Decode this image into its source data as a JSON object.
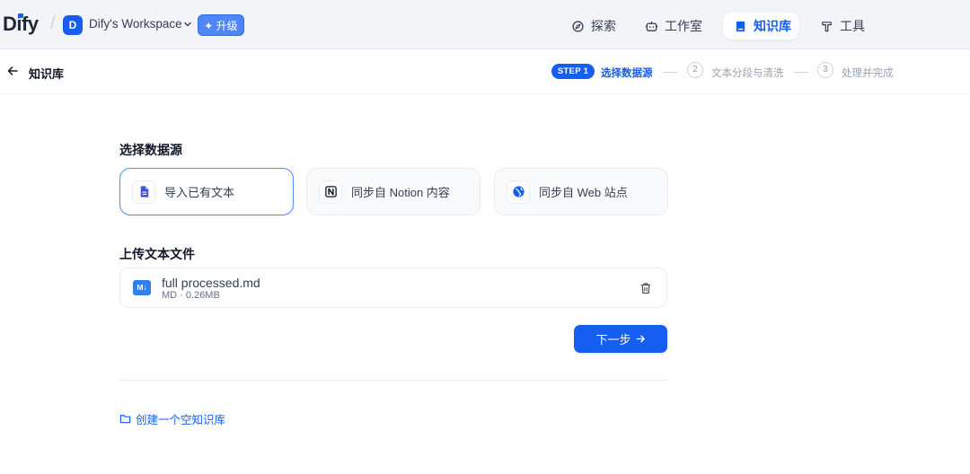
{
  "header": {
    "logo_prefix": "D",
    "logo_i": "i",
    "logo_suffix": "fy",
    "workspace_initial": "D",
    "workspace_name": "Dify's Workspace",
    "upgrade_label": "✦ 升级",
    "nav": [
      {
        "label": "探索",
        "icon": "compass-icon",
        "active": false
      },
      {
        "label": "工作室",
        "icon": "robot-icon",
        "active": false
      },
      {
        "label": "知识库",
        "icon": "book-icon",
        "active": true
      },
      {
        "label": "工具",
        "icon": "tools-icon",
        "active": false
      }
    ]
  },
  "subheader": {
    "title": "知识库",
    "steps": [
      {
        "badge": "STEP 1",
        "label": "选择数据源",
        "active": true
      },
      {
        "number": "2",
        "label": "文本分段与清洗",
        "active": false
      },
      {
        "number": "3",
        "label": "处理并完成",
        "active": false
      }
    ]
  },
  "main": {
    "source_title": "选择数据源",
    "sources": [
      {
        "label": "导入已有文本",
        "icon": "document-icon",
        "selected": true
      },
      {
        "label": "同步自 Notion 内容",
        "icon": "notion-icon",
        "selected": false
      },
      {
        "label": "同步自 Web 站点",
        "icon": "globe-icon",
        "selected": false
      }
    ],
    "upload_title": "上传文本文件",
    "file": {
      "icon_text": "M↓",
      "name": "full processed.md",
      "meta": "MD · 0.26MB"
    },
    "next_label": "下一步",
    "create_empty_label": "创建一个空知识库"
  },
  "colors": {
    "accent": "#155eef",
    "header_bg": "#f2f4f7"
  }
}
